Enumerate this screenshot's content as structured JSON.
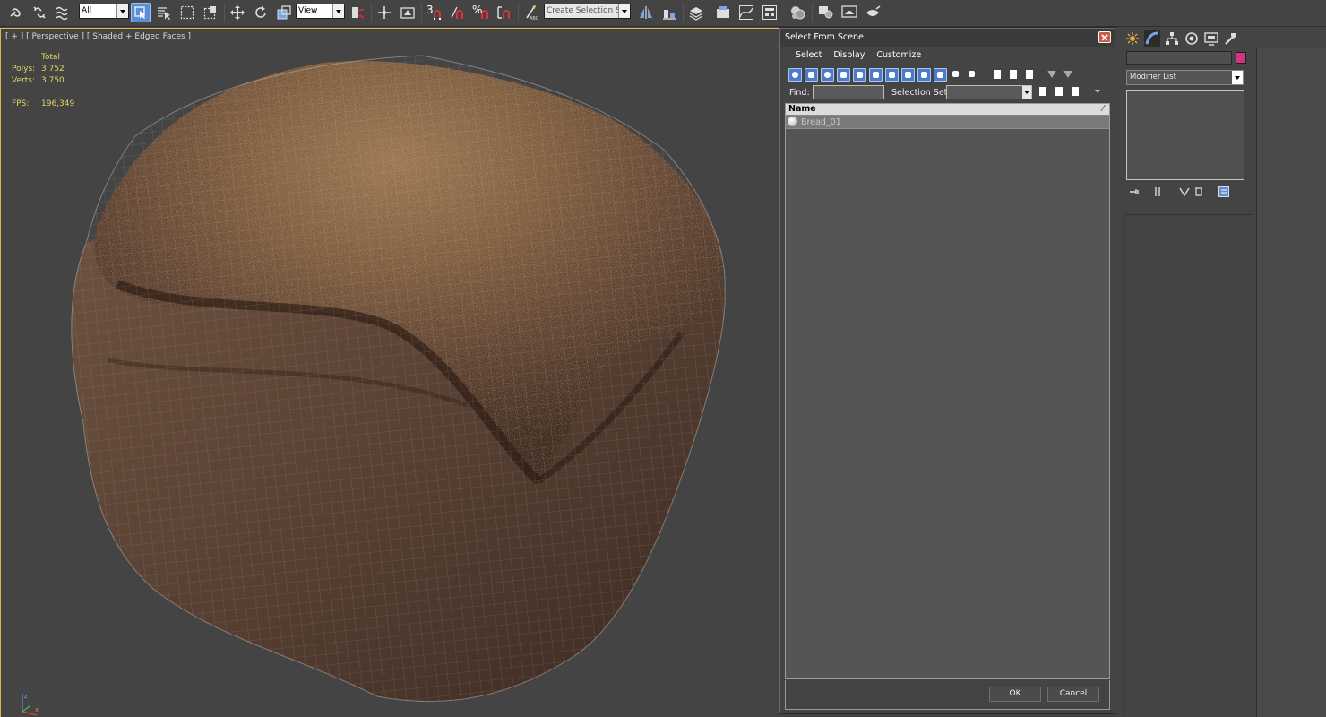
{
  "toolbar": {
    "selection_filter": "All",
    "reference_coord": "View",
    "named_selection": "Create Selection Se",
    "snap_label": "3",
    "angle_snap_label": "",
    "percent_snap_label": "%",
    "icons": [
      "link-icon",
      "unlink-icon",
      "bind-spacewarp-icon",
      "select-object-icon",
      "select-by-name-icon",
      "rect-region-icon",
      "window-crossing-icon",
      "move-icon",
      "rotate-icon",
      "scale-icon",
      "pivot-icon",
      "select-manipulate-icon",
      "keyboard-shortcut-icon",
      "snap-icon",
      "angle-snap-icon",
      "percent-snap-icon",
      "spinner-snap-icon",
      "edit-named-selection-icon",
      "mirror-icon",
      "align-icon",
      "layer-manager-icon",
      "graphite-icon",
      "curve-editor-icon",
      "schematic-view-icon",
      "material-editor-icon",
      "render-setup-icon",
      "rendered-frame-icon",
      "render-icon"
    ]
  },
  "viewport": {
    "label": "[ + ] [ Perspective ] [ Shaded + Edged Faces ]",
    "stats": {
      "total_label": "Total",
      "polys_label": "Polys:",
      "polys_value": "3 752",
      "verts_label": "Verts:",
      "verts_value": "3 750",
      "fps_label": "FPS:",
      "fps_value": "196,349"
    },
    "axis": {
      "z": "z",
      "x": "x"
    }
  },
  "dialog": {
    "title": "Select From Scene",
    "menus": [
      "Select",
      "Display",
      "Customize"
    ],
    "find_label": "Find:",
    "find_value": "",
    "selection_set_label": "Selection Set:",
    "selection_set_value": "",
    "column_name": "Name",
    "column_sort": "⁄",
    "objects": [
      {
        "name": "Bread_01"
      }
    ],
    "ok_label": "OK",
    "cancel_label": "Cancel"
  },
  "command_panel": {
    "tabs": [
      "create-tab",
      "modify-tab",
      "hierarchy-tab",
      "motion-tab",
      "display-tab",
      "utilities-tab"
    ],
    "object_name": "",
    "object_color": "#d2357e",
    "modifier_list_label": "Modifier List"
  }
}
